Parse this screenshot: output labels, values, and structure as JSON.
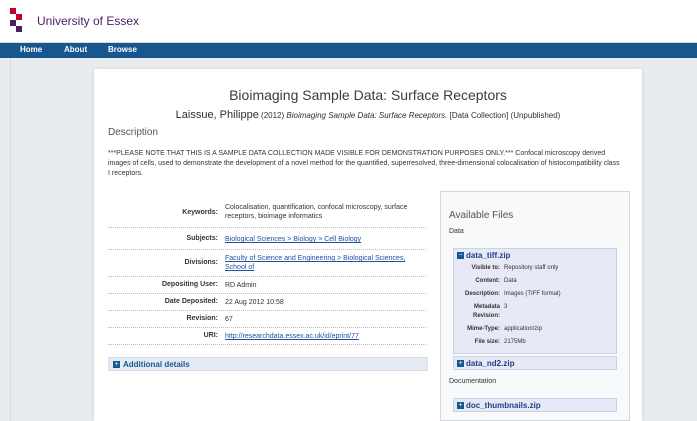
{
  "header": {
    "logo_text": "University of Essex"
  },
  "nav": {
    "items": [
      "Home",
      "About",
      "Browse"
    ]
  },
  "page": {
    "title": "Bioimaging Sample Data: Surface Receptors",
    "citation": {
      "author": "Laissue, Philippe",
      "year": "(2012)",
      "title": "Bioimaging Sample Data: Surface Receptors.",
      "suffix": "[Data Collection] (Unpublished)"
    },
    "description_heading": "Description",
    "description_text": "***PLEASE NOTE THAT THIS IS A SAMPLE DATA COLLECTION MADE VISIBLE FOR DEMONSTRATION PURPOSES ONLY.***  Confocal microscopy derived images of cells, used to demonstrate the development of a novel method for the quantified, superresolved, three-dimensional colocalisation of histocompatibility class I receptors."
  },
  "metadata": [
    {
      "key": "Keywords:",
      "value": "Colocalisation, quantification, confocal microscopy, surface receptors, bioimage informatics"
    },
    {
      "key": "Subjects:",
      "value": "Biological Sciences > Biology > Cell Biology"
    },
    {
      "key": "Divisions:",
      "value": "Faculty of Science and Engineering > Biological Sciences, School of"
    },
    {
      "key": "Depositing User:",
      "value": "RD Admin"
    },
    {
      "key": "Date Deposited:",
      "value": "22 Aug 2012 10:58"
    },
    {
      "key": "Revision:",
      "value": "67"
    },
    {
      "key": "URI:",
      "value": "http://researchdata.essex.ac.uk/id/eprint/77"
    }
  ],
  "additional_details": "Additional details",
  "files": {
    "heading": "Available Files",
    "data_label": "Data",
    "doc_label": "Documentation",
    "file1": {
      "name": "data_tiff.zip",
      "fields": [
        {
          "key": "Visible to:",
          "value": "Repository staff only"
        },
        {
          "key": "Content:",
          "value": "Data"
        },
        {
          "key": "Description:",
          "value": "Images (TIFF format)"
        },
        {
          "key": "Metadata",
          "value": "3"
        },
        {
          "key": "Revision:",
          "value": ""
        },
        {
          "key": "Mime-Type:",
          "value": "application/zip"
        },
        {
          "key": "File size:",
          "value": "2175Mb"
        }
      ]
    },
    "file2": {
      "name": "data_nd2.zip"
    },
    "file3": {
      "name": "doc_thumbnails.zip"
    }
  }
}
